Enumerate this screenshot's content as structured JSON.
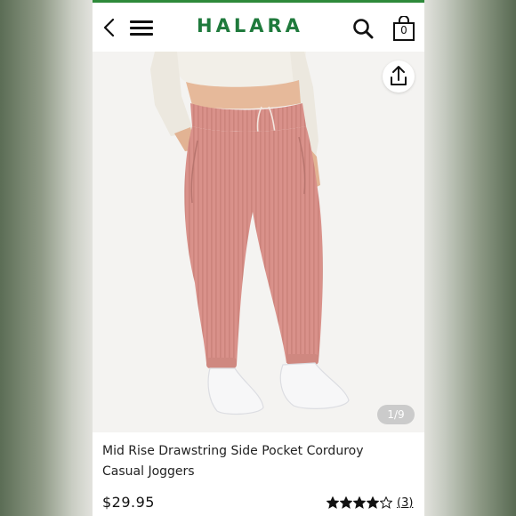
{
  "header": {
    "logo": "HALARA",
    "cart_count": "0"
  },
  "gallery": {
    "counter": "1/9"
  },
  "product": {
    "title": "Mid Rise Drawstring Side Pocket Corduroy Casual Joggers",
    "price": "$29.95",
    "rating_stars": 4,
    "rating_max": 5,
    "review_count": "(3)"
  },
  "colors": {
    "brand": "#1f7a3c",
    "top_accent": "#2e8a3a",
    "pants": "#d9918a"
  },
  "icons": [
    "back-icon",
    "menu-icon",
    "search-icon",
    "bag-icon",
    "share-icon",
    "star-icon"
  ]
}
